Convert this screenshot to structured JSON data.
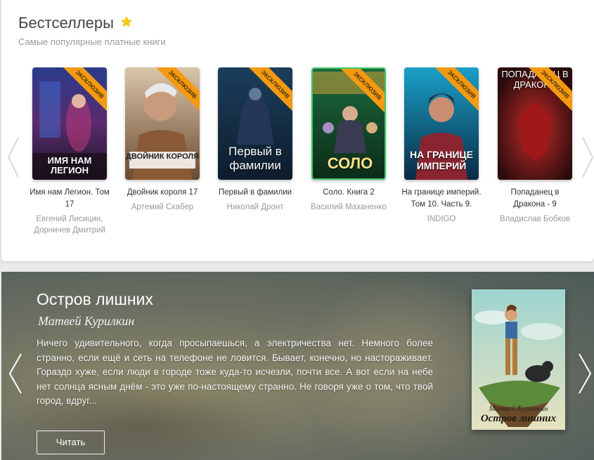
{
  "bestsellers": {
    "title": "Бестселлеры",
    "subtitle": "Самые популярные платные книги",
    "ribbon_label": "эксклюзив",
    "books": [
      {
        "title": "Имя нам Легион. Том 17",
        "author": "Евгений Лисицин, Дорничев Дмитрий",
        "cover_text": "ИМЯ НАМ ЛЕГИОН"
      },
      {
        "title": "Двойник короля 17",
        "author": "Артемий Скабер",
        "cover_text": "ДВОЙНИК КОРОЛЯ"
      },
      {
        "title": "Первый в фамилии",
        "author": "Николай Дронт",
        "cover_text": "Первый в фамилии"
      },
      {
        "title": "Соло. Книга 2",
        "author": "Василий Маханенко",
        "cover_text": "СОЛО"
      },
      {
        "title": "На границе империй. Том 10. Часть 9.",
        "author": "INDIGO",
        "cover_text": "НА ГРАНИЦЕ ИМПЕРИЙ"
      },
      {
        "title": "Попаданец в Дракона - 9",
        "author": "Владислав Бобков",
        "cover_text": "ПОПАДАНЕЦ В ДРАКОНА"
      }
    ]
  },
  "featured": {
    "title": "Остров лишних",
    "author": "Матвей Курилкин",
    "description": "Ничего удивительного, когда просыпаешься, а электричества нет. Немного более странно, если ещё и сеть на телефоне не ловится. Бывает, конечно, но настораживает. Гораздо хуже, если люди в городе тоже куда-то исчезли, почти все. А вот если на небе нет солнца ясным днём - это уже по-настоящему странно. Не говоря уже о том, что твой город, вдруг...",
    "read_button": "Читать",
    "cover_author": "Матвей Курилкин",
    "cover_title": "Остров лишних"
  },
  "colors": {
    "ribbon": "#f39a12",
    "star": "#f5c518"
  },
  "icons": [
    "star-icon",
    "chevron-left-icon",
    "chevron-right-icon"
  ]
}
